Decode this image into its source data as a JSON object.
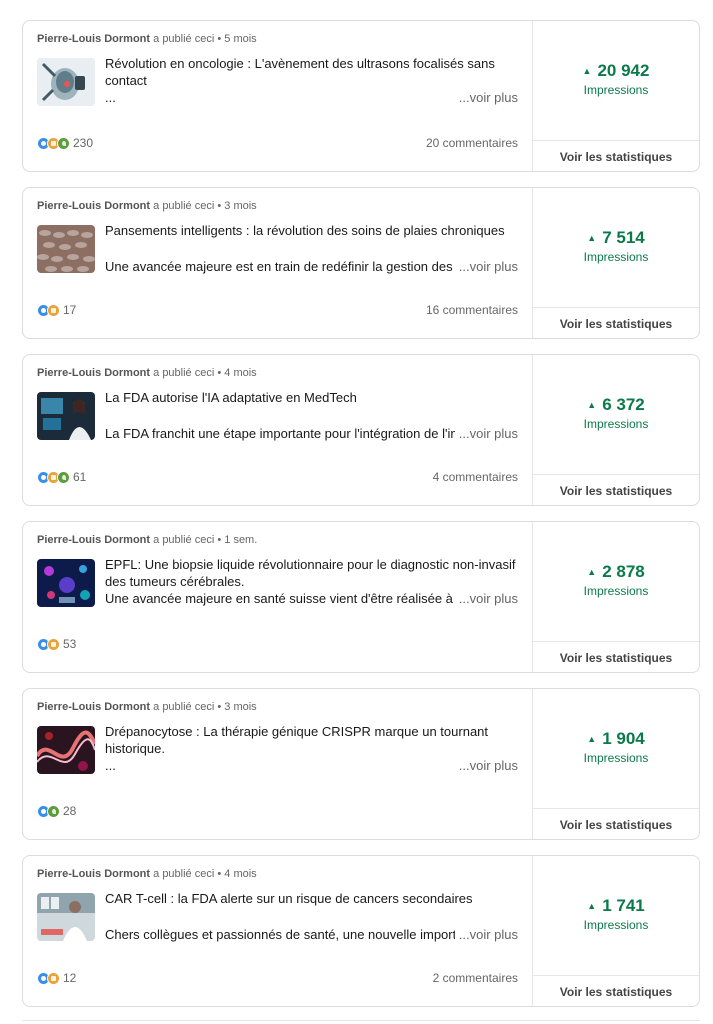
{
  "published_label": "a publié ceci •",
  "voir_plus_label": "...voir plus",
  "impressions_label": "Impressions",
  "stats_label": "Voir les statistiques",
  "posts": [
    {
      "author": "Pierre-Louis Dormont",
      "age": "5 mois",
      "title": "Révolution en oncologie : L'avènement des ultrasons focalisés sans contact",
      "preview": "...",
      "reaction_count": "230",
      "reaction_icons": [
        "like-reaction-icon",
        "celebrate-reaction-icon",
        "support-reaction-icon"
      ],
      "comments": "20 commentaires",
      "impressions": "20 942",
      "thumb": "ultrasound"
    },
    {
      "author": "Pierre-Louis Dormont",
      "age": "3 mois",
      "title": "Pansements intelligents : la révolution des soins de plaies chroniques",
      "preview": "Une avancée majeure est en train de redéfinir la gestion des pl",
      "reaction_count": "17",
      "reaction_icons": [
        "like-reaction-icon",
        "celebrate-reaction-icon"
      ],
      "comments": "16 commentaires",
      "impressions": "7 514",
      "thumb": "dressing"
    },
    {
      "author": "Pierre-Louis Dormont",
      "age": "4 mois",
      "title": "La FDA autorise l'IA adaptative en MedTech",
      "preview": "La FDA franchit une étape importante pour l'intégration de l'int",
      "reaction_count": "61",
      "reaction_icons": [
        "like-reaction-icon",
        "celebrate-reaction-icon",
        "support-reaction-icon"
      ],
      "comments": "4 commentaires",
      "impressions": "6 372",
      "thumb": "ai"
    },
    {
      "author": "Pierre-Louis Dormont",
      "age": "1 sem.",
      "title": "EPFL: Une biopsie liquide révolutionnaire pour le diagnostic non-invasif des tumeurs cérébrales.",
      "preview": "Une avancée majeure en santé suisse vient d'être réalisée à l'EF",
      "reaction_count": "53",
      "reaction_icons": [
        "like-reaction-icon",
        "celebrate-reaction-icon"
      ],
      "comments": "",
      "impressions": "2 878",
      "thumb": "biopsy"
    },
    {
      "author": "Pierre-Louis Dormont",
      "age": "3 mois",
      "title": "Drépanocytose : La thérapie génique CRISPR marque un tournant historique.",
      "preview": "...",
      "reaction_count": "28",
      "reaction_icons": [
        "like-reaction-icon",
        "support-reaction-icon"
      ],
      "comments": "",
      "impressions": "1 904",
      "thumb": "dna"
    },
    {
      "author": "Pierre-Louis Dormont",
      "age": "4 mois",
      "title": "CAR T-cell : la FDA alerte sur un risque de cancers secondaires",
      "preview": "Chers collègues et passionnés de santé, une nouvelle importan",
      "reaction_count": "12",
      "reaction_icons": [
        "like-reaction-icon",
        "celebrate-reaction-icon"
      ],
      "comments": "2 commentaires",
      "impressions": "1 741",
      "thumb": "lab"
    }
  ]
}
